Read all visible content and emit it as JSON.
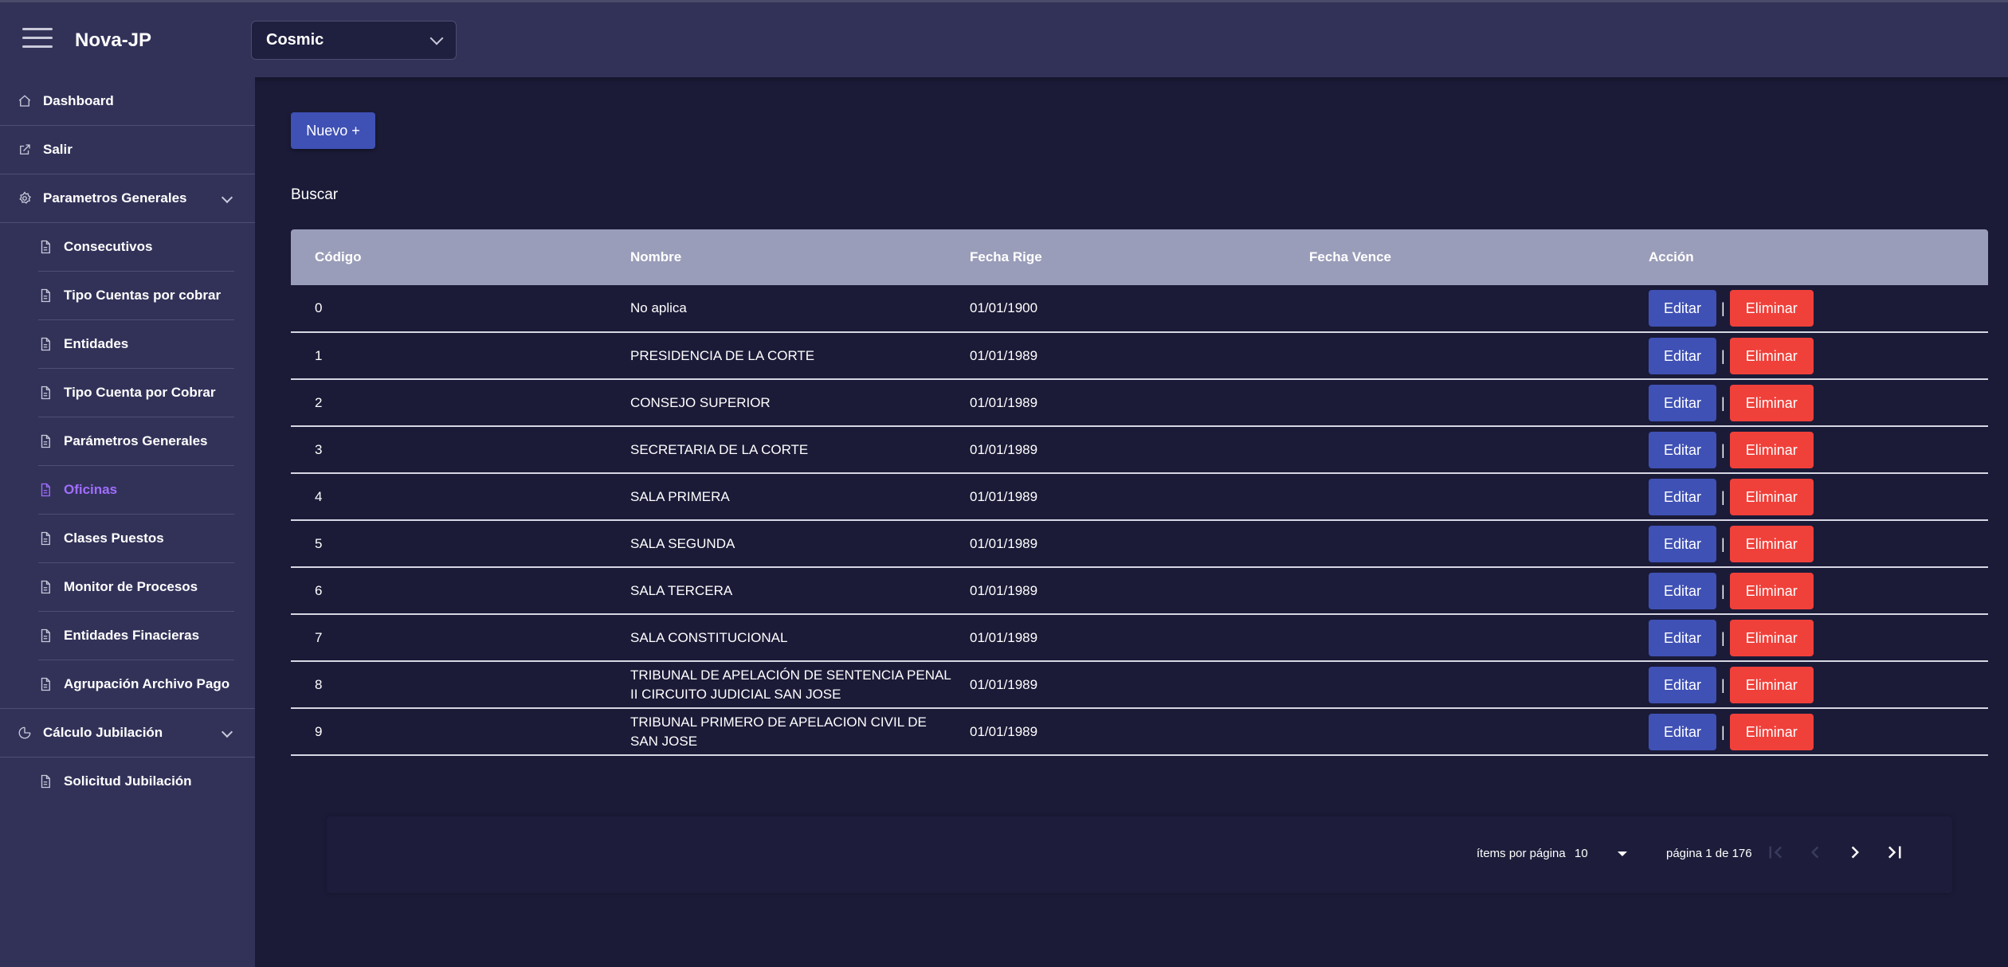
{
  "header": {
    "app_title": "Nova-JP",
    "theme_selected": "Cosmic"
  },
  "sidebar": {
    "items": [
      {
        "label": "Dashboard",
        "icon": "home-icon"
      },
      {
        "label": "Salir",
        "icon": "external-link-icon"
      },
      {
        "label": "Parametros Generales",
        "icon": "settings-icon",
        "expanded": true
      },
      {
        "label": "Consecutivos",
        "icon": "file-icon"
      },
      {
        "label": "Tipo Cuentas por cobrar",
        "icon": "file-icon"
      },
      {
        "label": "Entidades",
        "icon": "file-icon"
      },
      {
        "label": "Tipo Cuenta por Cobrar",
        "icon": "file-icon"
      },
      {
        "label": "Parámetros Generales",
        "icon": "file-icon"
      },
      {
        "label": "Oficinas",
        "icon": "file-icon",
        "active": true
      },
      {
        "label": "Clases Puestos",
        "icon": "file-icon"
      },
      {
        "label": "Monitor de Procesos",
        "icon": "file-icon"
      },
      {
        "label": "Entidades Finacieras",
        "icon": "file-icon"
      },
      {
        "label": "Agrupación Archivo Pago",
        "icon": "file-icon"
      },
      {
        "label": "Cálculo Jubilación",
        "icon": "pie-chart-icon",
        "expanded": true
      },
      {
        "label": "Solicitud Jubilación",
        "icon": "file-icon"
      }
    ],
    "active_color": "#a16eff"
  },
  "main": {
    "new_button": "Nuevo +",
    "search_label": "Buscar",
    "table": {
      "headers": [
        "Código",
        "Nombre",
        "Fecha Rige",
        "Fecha Vence",
        "Acción"
      ],
      "edit_label": "Editar",
      "separator": "|",
      "delete_label": "Eliminar",
      "rows": [
        {
          "codigo": "0",
          "nombre": "No aplica",
          "rige": "01/01/1900",
          "vence": ""
        },
        {
          "codigo": "1",
          "nombre": "PRESIDENCIA DE LA CORTE",
          "rige": "01/01/1989",
          "vence": ""
        },
        {
          "codigo": "2",
          "nombre": "CONSEJO SUPERIOR",
          "rige": "01/01/1989",
          "vence": ""
        },
        {
          "codigo": "3",
          "nombre": "SECRETARIA DE LA CORTE",
          "rige": "01/01/1989",
          "vence": ""
        },
        {
          "codigo": "4",
          "nombre": "SALA PRIMERA",
          "rige": "01/01/1989",
          "vence": ""
        },
        {
          "codigo": "5",
          "nombre": "SALA SEGUNDA",
          "rige": "01/01/1989",
          "vence": ""
        },
        {
          "codigo": "6",
          "nombre": "SALA TERCERA",
          "rige": "01/01/1989",
          "vence": ""
        },
        {
          "codigo": "7",
          "nombre": "SALA CONSTITUCIONAL",
          "rige": "01/01/1989",
          "vence": ""
        },
        {
          "codigo": "8",
          "nombre": "TRIBUNAL DE APELACIÓN DE SENTENCIA PENAL II CIRCUITO JUDICIAL SAN JOSE",
          "rige": "01/01/1989",
          "vence": ""
        },
        {
          "codigo": "9",
          "nombre": "TRIBUNAL PRIMERO DE APELACION CIVIL DE SAN JOSE",
          "rige": "01/01/1989",
          "vence": ""
        }
      ]
    },
    "paginator": {
      "items_label": "ítems por página",
      "page_size": "10",
      "range_label": "página 1 de 176"
    }
  },
  "colors": {
    "header_bg": "#323259",
    "main_bg": "#1b1b38",
    "primary": "#3f51b5",
    "danger": "#f0403a",
    "table_header": "#9a9db9"
  }
}
